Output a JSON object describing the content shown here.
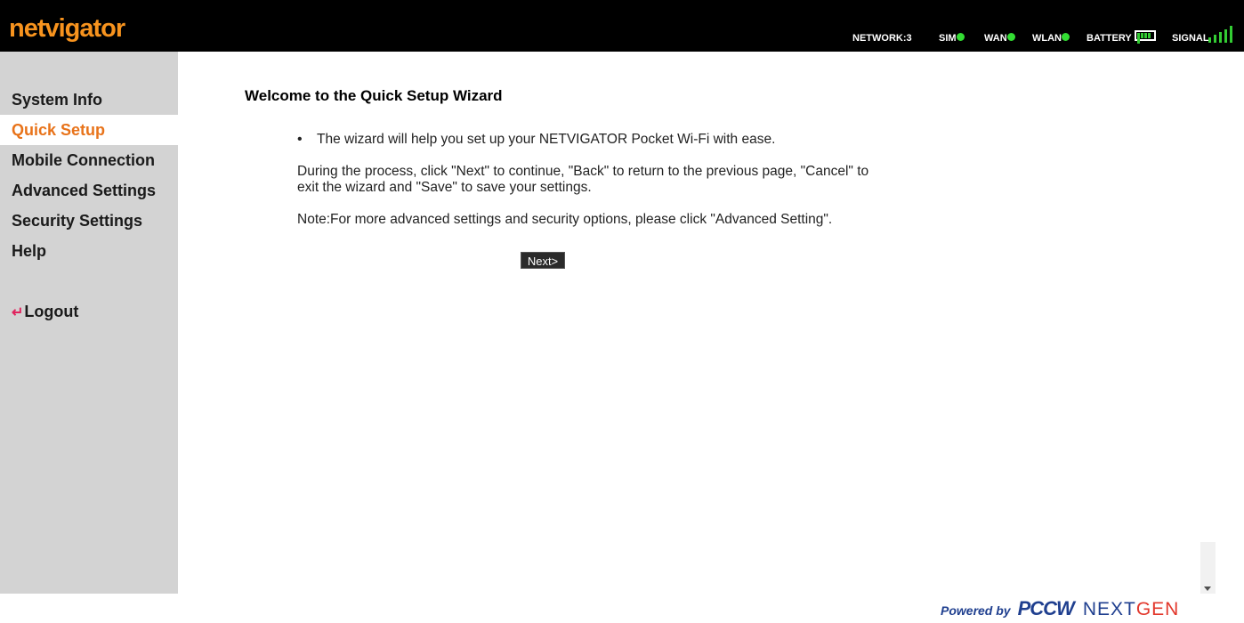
{
  "header": {
    "logo_text": "netvigator",
    "status": {
      "network": "NETWORK:3",
      "sim": "SIM",
      "wan": "WAN",
      "wlan": "WLAN",
      "battery": "BATTERY",
      "signal": "SIGNAL"
    },
    "indicator_color": "#33dd33",
    "battery_level_bars": 5,
    "signal_level_bars": 5
  },
  "sidebar": {
    "items": [
      {
        "label": "System Info"
      },
      {
        "label": "Quick Setup",
        "active": true
      },
      {
        "label": "Mobile Connection"
      },
      {
        "label": "Advanced Settings"
      },
      {
        "label": "Security Settings"
      },
      {
        "label": "Help"
      }
    ],
    "logout": "Logout",
    "active_color": "#e8731a"
  },
  "main": {
    "title": "Welcome to the Quick Setup Wizard",
    "bullet": "The wizard will help you set up your NETVIGATOR Pocket Wi-Fi with ease.",
    "paragraph": "During the process, click \"Next\" to continue, \"Back\" to return to the previous page, \"Cancel\" to exit the wizard and \"Save\" to save your settings.",
    "note": "Note:For more advanced settings and security options, please click \"Advanced Setting\".",
    "next_button": "Next>"
  },
  "footer": {
    "powered_by": "Powered by",
    "brand": "PCCW",
    "next": "NEXT",
    "gen": "GEN"
  }
}
